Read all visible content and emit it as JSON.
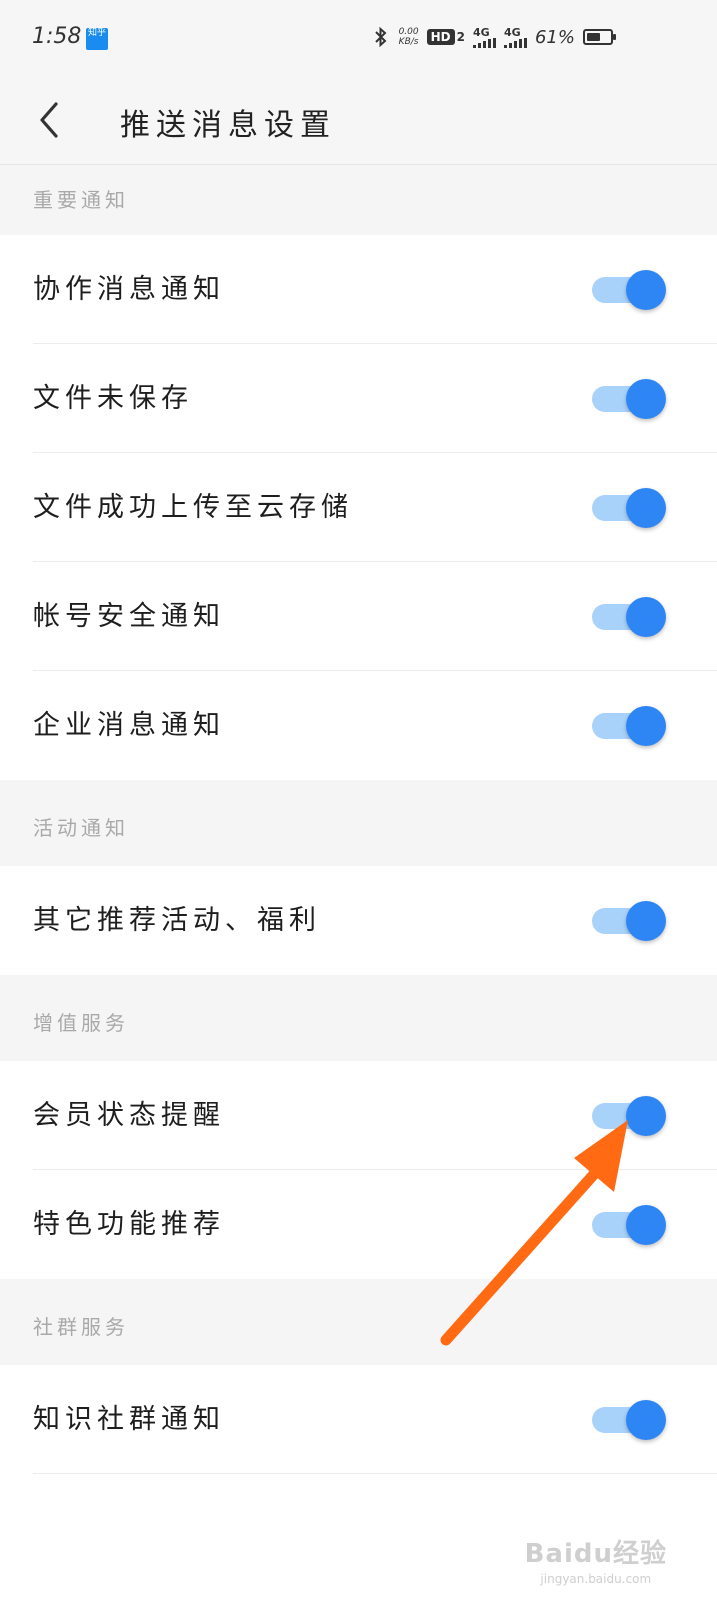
{
  "status_bar": {
    "time": "1:58",
    "app_badge": "知乎",
    "net_speed": "0.00",
    "net_speed_unit": "KB/s",
    "hd_label": "HD",
    "hd_sub": "2",
    "signal1_label": "4G",
    "signal2_label": "4G",
    "battery_text": "61%",
    "battery_level": 0.61
  },
  "header": {
    "title": "推送消息设置"
  },
  "sections": [
    {
      "title": "重要通知",
      "items": [
        {
          "label": "协作消息通知",
          "enabled": true
        },
        {
          "label": "文件未保存",
          "enabled": true
        },
        {
          "label": "文件成功上传至云存储",
          "enabled": true
        },
        {
          "label": "帐号安全通知",
          "enabled": true
        },
        {
          "label": "企业消息通知",
          "enabled": true
        }
      ]
    },
    {
      "title": "活动通知",
      "items": [
        {
          "label": "其它推荐活动、福利",
          "enabled": true
        }
      ]
    },
    {
      "title": "增值服务",
      "items": [
        {
          "label": "会员状态提醒",
          "enabled": true
        },
        {
          "label": "特色功能推荐",
          "enabled": true
        }
      ]
    },
    {
      "title": "社群服务",
      "items": [
        {
          "label": "知识社群通知",
          "enabled": true
        }
      ]
    }
  ],
  "colors": {
    "toggle_on_knob": "#2e86f5",
    "toggle_on_track": "#a9d2fb",
    "annotation_arrow": "#ff6a13"
  },
  "watermark": {
    "main": "Baidu经验",
    "sub": "jingyan.baidu.com"
  }
}
